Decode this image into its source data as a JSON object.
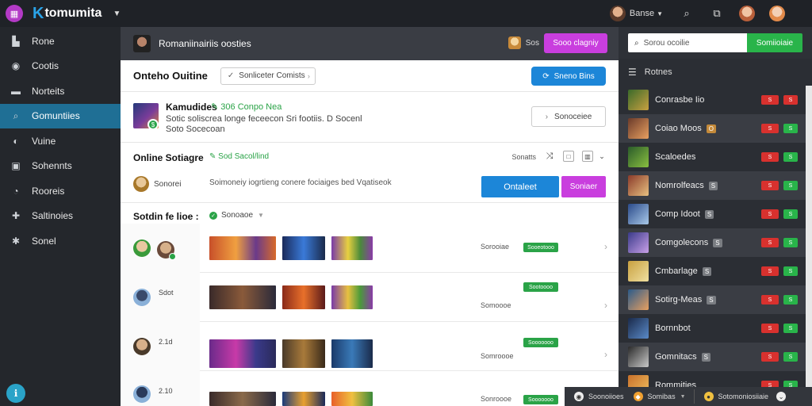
{
  "topbar": {
    "brand": "tomumita",
    "brand_letter": "K",
    "user_label": "Banse",
    "icon_names": [
      "app-icon",
      "search-icon",
      "share-icon"
    ]
  },
  "sidebar": {
    "items": [
      {
        "label": "Rone",
        "icon": "home-icon"
      },
      {
        "label": "Cootis",
        "icon": "globe-icon"
      },
      {
        "label": "Norteits",
        "icon": "folder-icon"
      },
      {
        "label": "Gomuntiies",
        "icon": "search-icon"
      },
      {
        "label": "Vuine",
        "icon": "chat-icon"
      },
      {
        "label": "Sohennts",
        "icon": "calendar-icon"
      },
      {
        "label": "Rooreis",
        "icon": "comment-icon"
      },
      {
        "label": "Saltinoies",
        "icon": "gamepad-icon"
      },
      {
        "label": "Sonel",
        "icon": "settings-icon"
      }
    ],
    "active_index": 3,
    "help_icon": "info-icon"
  },
  "main": {
    "header": {
      "title": "Romaniinairiis oosties",
      "user": "Sos",
      "button": "Sooo clagniy"
    },
    "section1": {
      "heading": "Onteho Ouitine",
      "filter": "Sonliceter Comists",
      "button": "Sneno Bins"
    },
    "section2": {
      "name": "Kamudides",
      "tag": "306 Conpo Nea",
      "desc1": "Sotic soliscrea longe feceecon  Sri  footiis. D Socenl",
      "desc2": "Soto Socecoan",
      "button": "Sonoceiee"
    },
    "section3": {
      "heading": "Online Sotiagre",
      "tag": "Sod Sacol/lind",
      "control_label": "Sonatts",
      "who": "Sonorei",
      "message": "Soimoneiy iogrtieng conere fociaiges bed Vqatiseok",
      "primary": "Ontaleet",
      "secondary": "Soniaer"
    },
    "list": {
      "heading": "Sotdin fe lioe :",
      "sub": "Sonoaoe",
      "rows": [
        {
          "label": "",
          "meta": "Sorooiae",
          "pill": "Sooeotooo"
        },
        {
          "label": "Sdot",
          "meta": "Somoooe",
          "pill": "Sootoooo"
        },
        {
          "label": "2.1d",
          "meta": "Somroooe",
          "pill": "Sooooooo"
        },
        {
          "label": "2.10",
          "meta": "Sonroooe",
          "pill": "Sooooooo"
        }
      ]
    }
  },
  "right": {
    "search_placeholder": "Sorou ocoilie",
    "search_button": "Somiioiaie",
    "heading": "Rotnes",
    "items": [
      {
        "name": "Conrasbe Iio",
        "count": "",
        "red": "S",
        "badge": "S"
      },
      {
        "name": "Coiao Moos",
        "count": "O",
        "red": "S",
        "badge": "S"
      },
      {
        "name": "Scaloedes",
        "count": "",
        "red": "S",
        "badge": "S"
      },
      {
        "name": "Nomrolfeacs",
        "count": "S",
        "red": "S",
        "badge": "S"
      },
      {
        "name": "Comp Idoot",
        "count": "S",
        "red": "S",
        "badge": "S"
      },
      {
        "name": "Comgolecons",
        "count": "S",
        "red": "S",
        "badge": "S"
      },
      {
        "name": "Cmbarlage",
        "count": "S",
        "red": "S",
        "badge": "S"
      },
      {
        "name": "Sotirg-Meas",
        "count": "S",
        "red": "S",
        "badge": "S"
      },
      {
        "name": "Bornnbot",
        "count": "",
        "red": "S",
        "badge": "S"
      },
      {
        "name": "Gomnitacs",
        "count": "S",
        "red": "S",
        "badge": "S"
      },
      {
        "name": "Rommities",
        "count": "",
        "red": "S",
        "badge": "S"
      }
    ]
  },
  "bottom": {
    "item1": "Soonoiioes",
    "item2": "Somibas",
    "item3": "Sotomoniosiiaie"
  },
  "colors": {
    "accent_blue": "#1c86d8",
    "accent_magenta": "#c93ede",
    "accent_green": "#29b44a",
    "active_sidebar": "#1f6f95"
  }
}
